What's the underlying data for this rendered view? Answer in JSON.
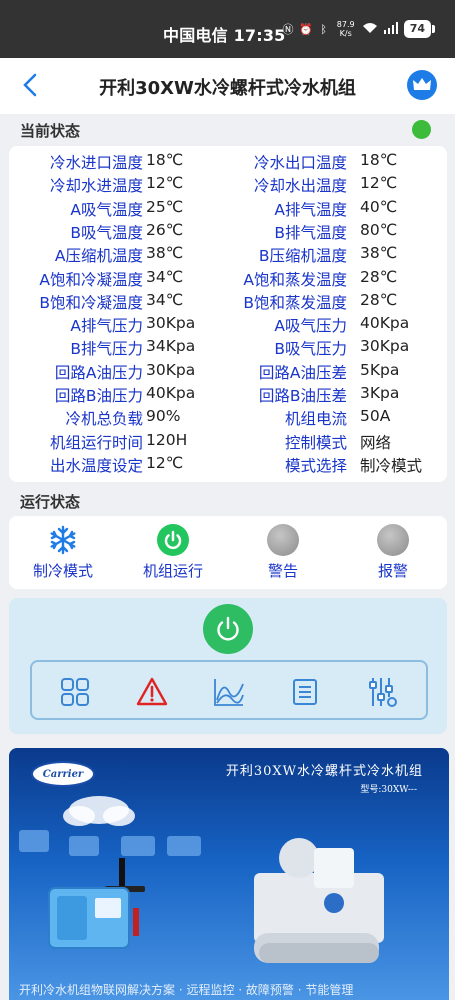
{
  "statusbar": {
    "text": "中国电信 17:35",
    "speed": "87.9 K/s",
    "battery": "74"
  },
  "header": {
    "title": "开利30XW水冷螺杆式冷水机组"
  },
  "current_state": {
    "title": "当前状态",
    "indicator_color": "#3dbb3a",
    "rows": [
      {
        "l1": "冷水进口温度",
        "v1": "18℃",
        "l2": "冷水出口温度",
        "v2": "18℃"
      },
      {
        "l1": "冷却水进温度",
        "v1": "12℃",
        "l2": "冷却水出温度",
        "v2": "12℃"
      },
      {
        "l1": "A吸气温度",
        "v1": "25℃",
        "l2": "A排气温度",
        "v2": "40℃"
      },
      {
        "l1": "B吸气温度",
        "v1": "26℃",
        "l2": "B排气温度",
        "v2": "80℃"
      },
      {
        "l1": "A压缩机温度",
        "v1": "38℃",
        "l2": "B压缩机温度",
        "v2": "38℃"
      },
      {
        "l1": "A饱和冷凝温度",
        "v1": "34℃",
        "l2": "A饱和蒸发温度",
        "v2": "28℃"
      },
      {
        "l1": "B饱和冷凝温度",
        "v1": "34℃",
        "l2": "B饱和蒸发温度",
        "v2": "28℃"
      },
      {
        "l1": "A排气压力",
        "v1": "30Kpa",
        "l2": "A吸气压力",
        "v2": "40Kpa"
      },
      {
        "l1": "B排气压力",
        "v1": "34Kpa",
        "l2": "B吸气压力",
        "v2": "30Kpa"
      },
      {
        "l1": "回路A油压力",
        "v1": "30Kpa",
        "l2": "回路A油压差",
        "v2": "5Kpa"
      },
      {
        "l1": "回路B油压力",
        "v1": "40Kpa",
        "l2": "回路B油压差",
        "v2": "3Kpa"
      },
      {
        "l1": "冷机总负载",
        "v1": "90%",
        "l2": "机组电流",
        "v2": "50A"
      },
      {
        "l1": "机组运行时间",
        "v1": "120H",
        "l2": "控制模式",
        "v2": "网络"
      },
      {
        "l1": "出水温度设定",
        "v1": "12℃",
        "l2": "模式选择",
        "v2": "制冷模式"
      }
    ]
  },
  "run_state": {
    "title": "运行状态",
    "items": [
      {
        "label": "制冷模式",
        "icon": "snowflake-icon"
      },
      {
        "label": "机组运行",
        "icon": "power-on-icon"
      },
      {
        "label": "警告",
        "icon": "warning-indicator"
      },
      {
        "label": "报警",
        "icon": "alarm-indicator"
      }
    ]
  },
  "control": {
    "power_icon": "power-icon",
    "tools": [
      "grid-icon",
      "warning-icon",
      "chart-icon",
      "list-icon",
      "sliders-icon"
    ]
  },
  "banner": {
    "logo": "Carrier",
    "title": "开利30XW水冷螺杆式冷水机组",
    "model": "型号:30XW---",
    "bottom_text": "开利冷水机组物联网解决方案 · 远程监控 · 故障预警 · 节能管理"
  }
}
